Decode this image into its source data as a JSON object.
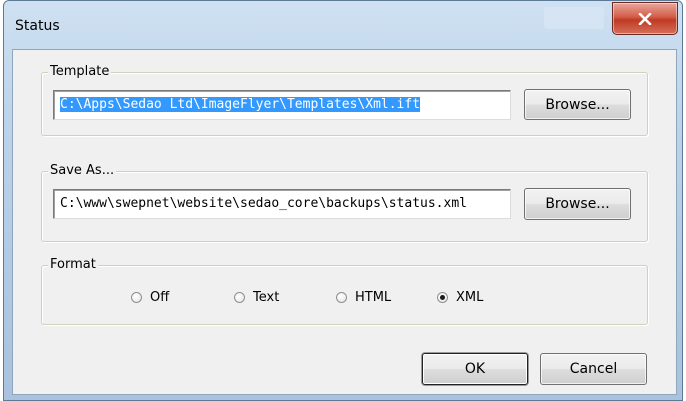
{
  "window": {
    "title": "Status"
  },
  "template": {
    "label": "Template",
    "path": "C:\\Apps\\Sedao Ltd\\ImageFlyer\\Templates\\Xml.ift",
    "browse_label": "Browse..."
  },
  "save_as": {
    "label": "Save As...",
    "path": "C:\\www\\swepnet\\website\\sedao_core\\backups\\status.xml",
    "browse_label": "Browse..."
  },
  "format": {
    "label": "Format",
    "options": [
      {
        "label": "Off"
      },
      {
        "label": "Text"
      },
      {
        "label": "HTML"
      },
      {
        "label": "XML"
      }
    ],
    "selected": "XML"
  },
  "actions": {
    "ok_label": "OK",
    "cancel_label": "Cancel"
  },
  "colors": {
    "selection": "#3399ff",
    "close_button": "#c13a22"
  }
}
